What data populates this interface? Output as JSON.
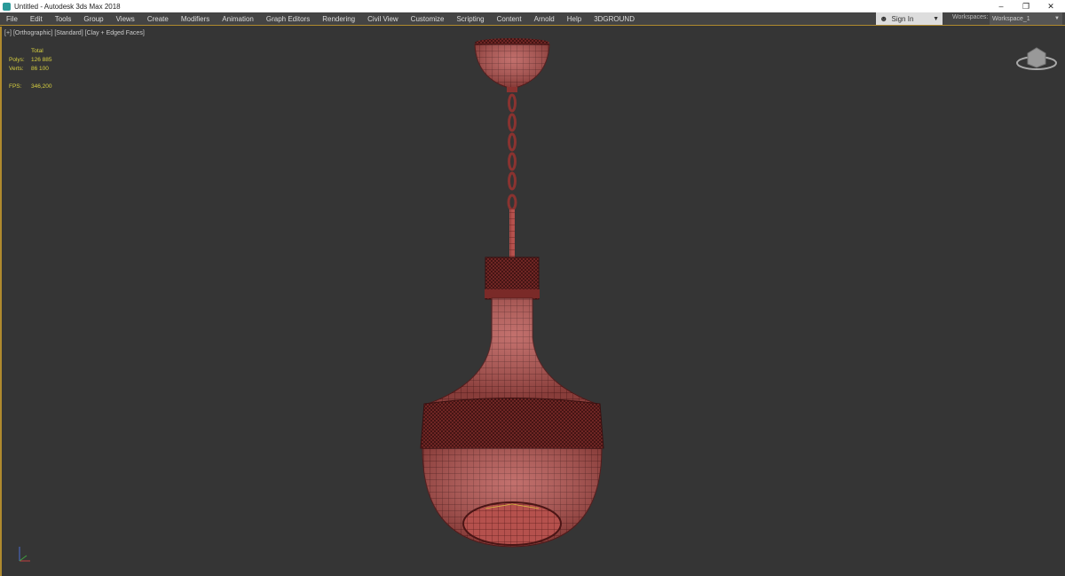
{
  "window": {
    "title": "Untitled - Autodesk 3ds Max 2018",
    "minimize": "–",
    "restore": "❐",
    "close": "✕"
  },
  "menu": [
    "File",
    "Edit",
    "Tools",
    "Group",
    "Views",
    "Create",
    "Modifiers",
    "Animation",
    "Graph Editors",
    "Rendering",
    "Civil View",
    "Customize",
    "Scripting",
    "Content",
    "Arnold",
    "Help",
    "3DGROUND"
  ],
  "signin": {
    "label": "Sign In",
    "icon": "user-icon"
  },
  "workspaces": {
    "label": "Workspaces:",
    "value": "Workspace_1"
  },
  "viewport": {
    "labels": [
      "[+]",
      "[Orthographic]",
      "[Standard]",
      "[Clay + Edged Faces]"
    ],
    "stats": {
      "header": "Total",
      "polys_label": "Polys:",
      "polys": "126 885",
      "verts_label": "Verts:",
      "verts": "86 100",
      "fps_label": "FPS:",
      "fps": "346,200"
    },
    "model_color": "#b5514d",
    "wire_color": "#5a1c1c",
    "border_color": "#b08a2e"
  }
}
